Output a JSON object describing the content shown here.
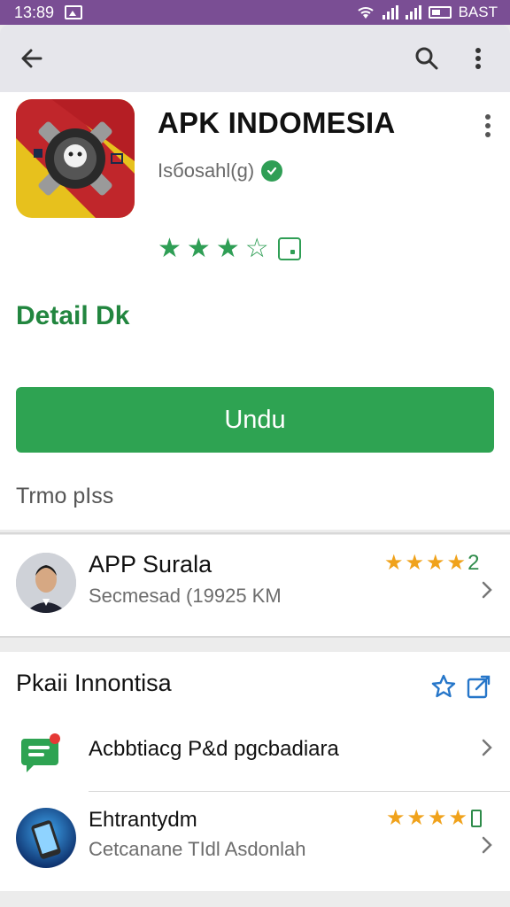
{
  "status_bar": {
    "time": "13:89",
    "right_text": "BAST"
  },
  "toolbar": {
    "back_icon": "arrow-back-icon",
    "search_icon": "search-icon",
    "more_icon": "more-vert-icon"
  },
  "app": {
    "title": "APK INDOMESIA",
    "developer": "Isбosahl(g)",
    "rating_stars": 3.5,
    "detail_heading": "Detail Dk",
    "install_label": "Undu",
    "section_label": "Trmo pIss"
  },
  "developer_card": {
    "name": "APP Surala",
    "subtitle": "Secmesad (19925 KM",
    "badge": "2"
  },
  "list_section": {
    "title": "Pkaii Innontisa",
    "items": [
      {
        "title": "Acbbtiacg P&d pgcbadiara",
        "subtitle": ""
      },
      {
        "title": "Ehtrantydm",
        "subtitle": "Cetcanane TIdl Asdonlah"
      }
    ]
  },
  "colors": {
    "status_bar": "#7a4e94",
    "accent_green": "#2ea352",
    "star_orange": "#f0a21b"
  }
}
